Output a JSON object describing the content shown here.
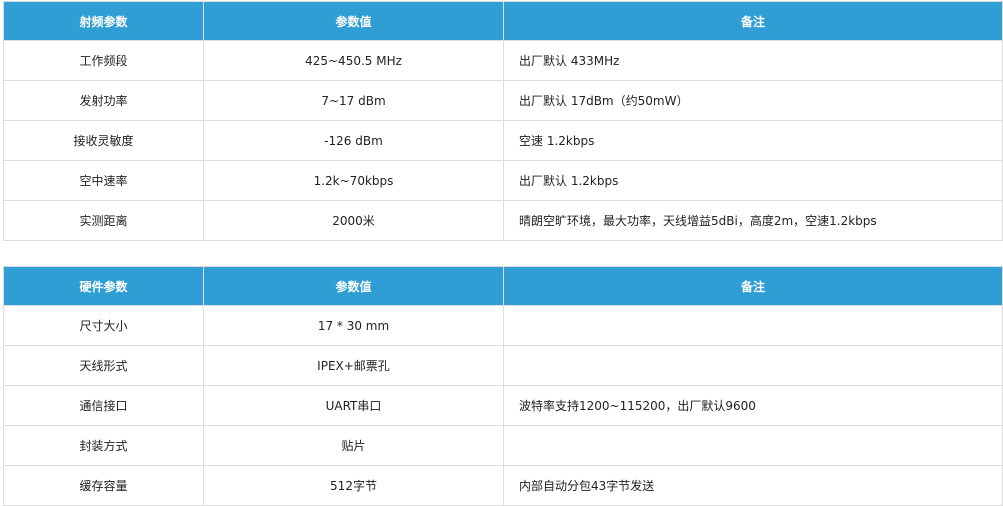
{
  "rf_table": {
    "headers": [
      "射频参数",
      "参数值",
      "备注"
    ],
    "rows": [
      [
        "工作频段",
        "425~450.5 MHz",
        "出厂默认 433MHz"
      ],
      [
        "发射功率",
        "7~17 dBm",
        "出厂默认 17dBm（约50mW）"
      ],
      [
        "接收灵敏度",
        "-126 dBm",
        "空速 1.2kbps"
      ],
      [
        "空中速率",
        "1.2k~70kbps",
        "出厂默认 1.2kbps"
      ],
      [
        "实测距离",
        "2000米",
        "晴朗空旷环境，最大功率，天线增益5dBi，高度2m，空速1.2kbps"
      ]
    ]
  },
  "hw_table": {
    "headers": [
      "硬件参数",
      "参数值",
      "备注"
    ],
    "rows": [
      [
        "尺寸大小",
        "17 * 30 mm",
        ""
      ],
      [
        "天线形式",
        "IPEX+邮票孔",
        ""
      ],
      [
        "通信接口",
        "UART串口",
        "波特率支持1200~115200，出厂默认9600"
      ],
      [
        "封装方式",
        "贴片",
        ""
      ],
      [
        "缓存容量",
        "512字节",
        "内部自动分包43字节发送"
      ]
    ]
  },
  "colors": {
    "header_bg": "#2f9ed5",
    "header_text": "#ffffff",
    "border": "#dcdcdc"
  }
}
